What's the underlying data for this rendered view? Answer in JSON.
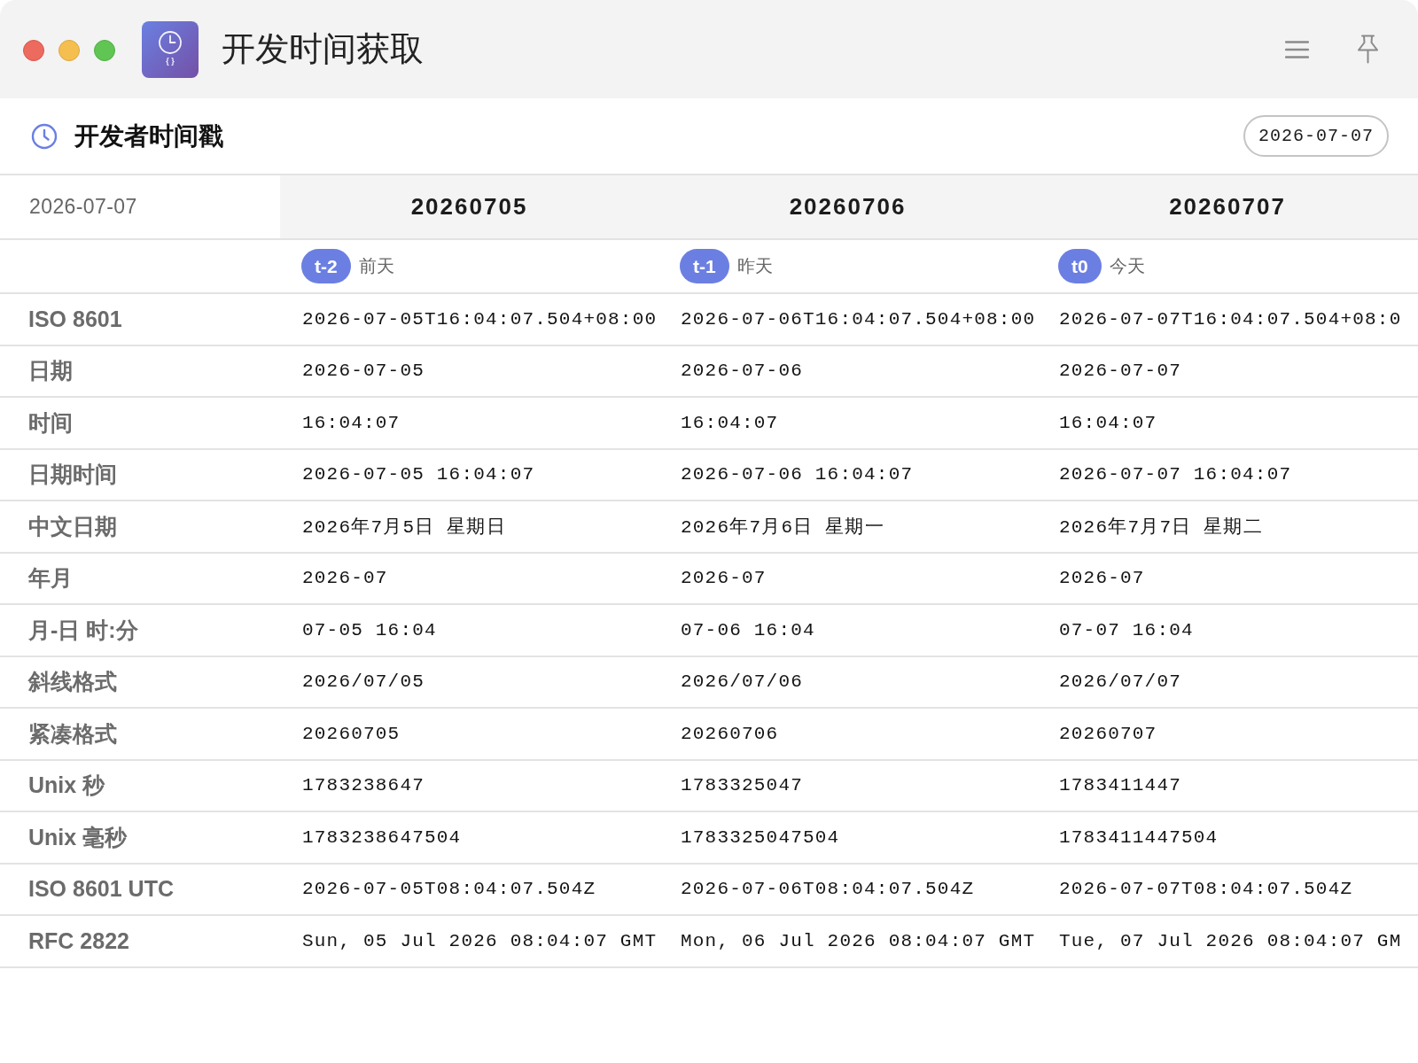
{
  "window": {
    "title": "开发时间获取",
    "logo_text": "{ }"
  },
  "header": {
    "title": "开发者时间戳",
    "date": "2026-07-07"
  },
  "table": {
    "corner": "2026-07-07",
    "columns": [
      {
        "date": "20260705",
        "badge": "t-2",
        "relative": "前天"
      },
      {
        "date": "20260706",
        "badge": "t-1",
        "relative": "昨天"
      },
      {
        "date": "20260707",
        "badge": "t0",
        "relative": "今天"
      }
    ],
    "rows": [
      {
        "label": "ISO 8601",
        "values": [
          "2026-07-05T16:04:07.504+08:00",
          "2026-07-06T16:04:07.504+08:00",
          "2026-07-07T16:04:07.504+08:0"
        ]
      },
      {
        "label": "日期",
        "values": [
          "2026-07-05",
          "2026-07-06",
          "2026-07-07"
        ]
      },
      {
        "label": "时间",
        "values": [
          "16:04:07",
          "16:04:07",
          "16:04:07"
        ]
      },
      {
        "label": "日期时间",
        "values": [
          "2026-07-05 16:04:07",
          "2026-07-06 16:04:07",
          "2026-07-07 16:04:07"
        ]
      },
      {
        "label": "中文日期",
        "values": [
          "2026年7月5日 星期日",
          "2026年7月6日 星期一",
          "2026年7月7日 星期二"
        ]
      },
      {
        "label": "年月",
        "values": [
          "2026-07",
          "2026-07",
          "2026-07"
        ]
      },
      {
        "label": "月-日 时:分",
        "values": [
          "07-05 16:04",
          "07-06 16:04",
          "07-07 16:04"
        ]
      },
      {
        "label": "斜线格式",
        "values": [
          "2026/07/05",
          "2026/07/06",
          "2026/07/07"
        ]
      },
      {
        "label": "紧凑格式",
        "values": [
          "20260705",
          "20260706",
          "20260707"
        ]
      },
      {
        "label": "Unix 秒",
        "values": [
          "1783238647",
          "1783325047",
          "1783411447"
        ]
      },
      {
        "label": "Unix 毫秒",
        "values": [
          "1783238647504",
          "1783325047504",
          "1783411447504"
        ]
      },
      {
        "label": "ISO 8601 UTC",
        "values": [
          "2026-07-05T08:04:07.504Z",
          "2026-07-06T08:04:07.504Z",
          "2026-07-07T08:04:07.504Z"
        ]
      },
      {
        "label": "RFC 2822",
        "values": [
          "Sun, 05 Jul 2026 08:04:07 GMT",
          "Mon, 06 Jul 2026 08:04:07 GMT",
          "Tue, 07 Jul 2026 08:04:07 GM"
        ]
      }
    ]
  }
}
